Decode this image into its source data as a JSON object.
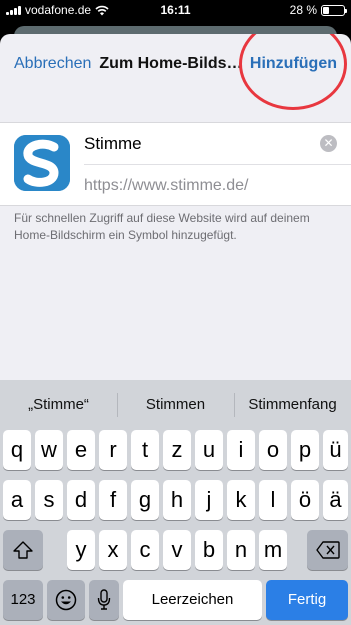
{
  "status_bar": {
    "carrier": "vodafone.de",
    "time": "16:11",
    "battery_text": "28 %",
    "battery_level": 0.28
  },
  "nav": {
    "cancel_label": "Abbrechen",
    "title": "Zum Home-Bilds…",
    "add_label": "Hinzufügen"
  },
  "form": {
    "name_value": "Stimme",
    "url": "https://www.stimme.de/",
    "clear_icon": "clear-circle-icon"
  },
  "hint": "Für schnellen Zugriff auf diese Website wird auf deinem Home-Bildschirm ein Symbol hinzugefügt.",
  "keyboard": {
    "suggestions": [
      "„Stimme“",
      "Stimmen",
      "Stimmenfang"
    ],
    "row1": [
      "q",
      "w",
      "e",
      "r",
      "t",
      "z",
      "u",
      "i",
      "o",
      "p",
      "ü"
    ],
    "row2": [
      "a",
      "s",
      "d",
      "f",
      "g",
      "h",
      "j",
      "k",
      "l",
      "ö",
      "ä"
    ],
    "row3": [
      "y",
      "x",
      "c",
      "v",
      "b",
      "n",
      "m"
    ],
    "numbers_label": "123",
    "space_label": "Leerzeichen",
    "done_label": "Fertig",
    "shift_icon": "shift-icon",
    "delete_icon": "delete-icon",
    "emoji_icon": "emoji-icon",
    "mic_icon": "microphone-icon"
  },
  "colors": {
    "accent": "#2a6fb8",
    "annotation": "#e8373f",
    "done_key": "#2b7fe6",
    "app_icon": "#2a87c8"
  }
}
